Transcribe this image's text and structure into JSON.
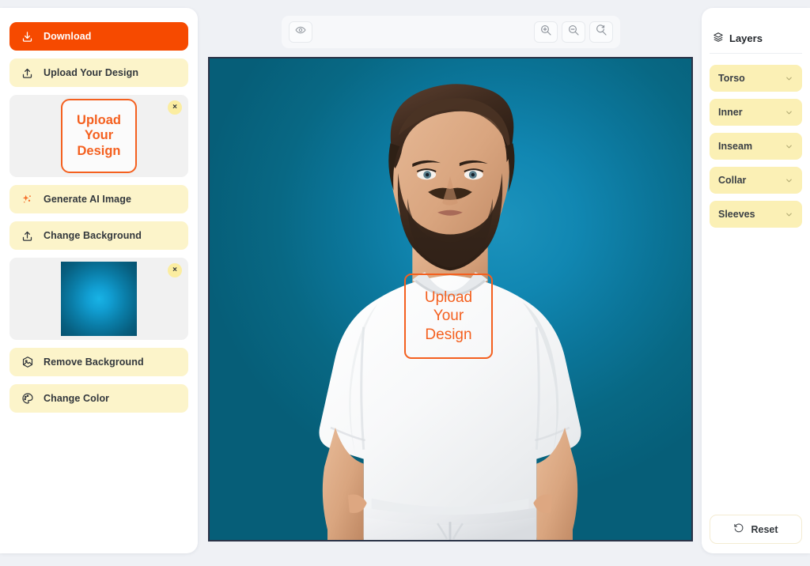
{
  "sidebar": {
    "tools": [
      {
        "label": "Download",
        "icon": "download-icon",
        "style": "primary"
      },
      {
        "label": "Upload Your Design",
        "icon": "upload-icon",
        "style": "soft"
      }
    ],
    "design_card": {
      "close_label": "×",
      "lines": [
        "Upload",
        "Your",
        "Design"
      ]
    },
    "tools2": [
      {
        "label": "Generate AI Image",
        "icon": "sparkle-icon",
        "style": "soft"
      },
      {
        "label": "Change Background",
        "icon": "upload-icon",
        "style": "soft"
      }
    ],
    "background_card": {
      "close_label": "×"
    },
    "tools3": [
      {
        "label": "Remove Background",
        "icon": "image-icon",
        "style": "soft"
      },
      {
        "label": "Change Color",
        "icon": "palette-icon",
        "style": "soft"
      }
    ]
  },
  "toolbar": {
    "preview_icon": "eye-icon",
    "zoom_in_icon": "zoom-in-icon",
    "zoom_out_icon": "zoom-out-icon",
    "zoom_reset_icon": "zoom-reset-icon"
  },
  "canvas": {
    "design_overlay": {
      "lines": [
        "Upload",
        "Your",
        "Design"
      ]
    },
    "background_color_center": "#1c93bd",
    "background_color_edge": "#065e78",
    "garment_color": "#ffffff",
    "border_color": "#2b3347"
  },
  "layers_panel": {
    "title": "Layers",
    "title_icon": "layers-icon",
    "items": [
      {
        "label": "Torso",
        "icon": "chevron-down-icon"
      },
      {
        "label": "Inner",
        "icon": "chevron-down-icon"
      },
      {
        "label": "Inseam",
        "icon": "chevron-down-icon"
      },
      {
        "label": "Collar",
        "icon": "chevron-down-icon"
      },
      {
        "label": "Sleeves",
        "icon": "chevron-down-icon"
      }
    ],
    "reset": {
      "label": "Reset",
      "icon": "reset-icon"
    }
  },
  "theme": {
    "accent_orange": "#f64a00",
    "design_orange": "#f4601f",
    "soft_yellow": "#fcf4ca",
    "layer_yellow": "#fbf0b5",
    "page_bg": "#eff1f5"
  }
}
